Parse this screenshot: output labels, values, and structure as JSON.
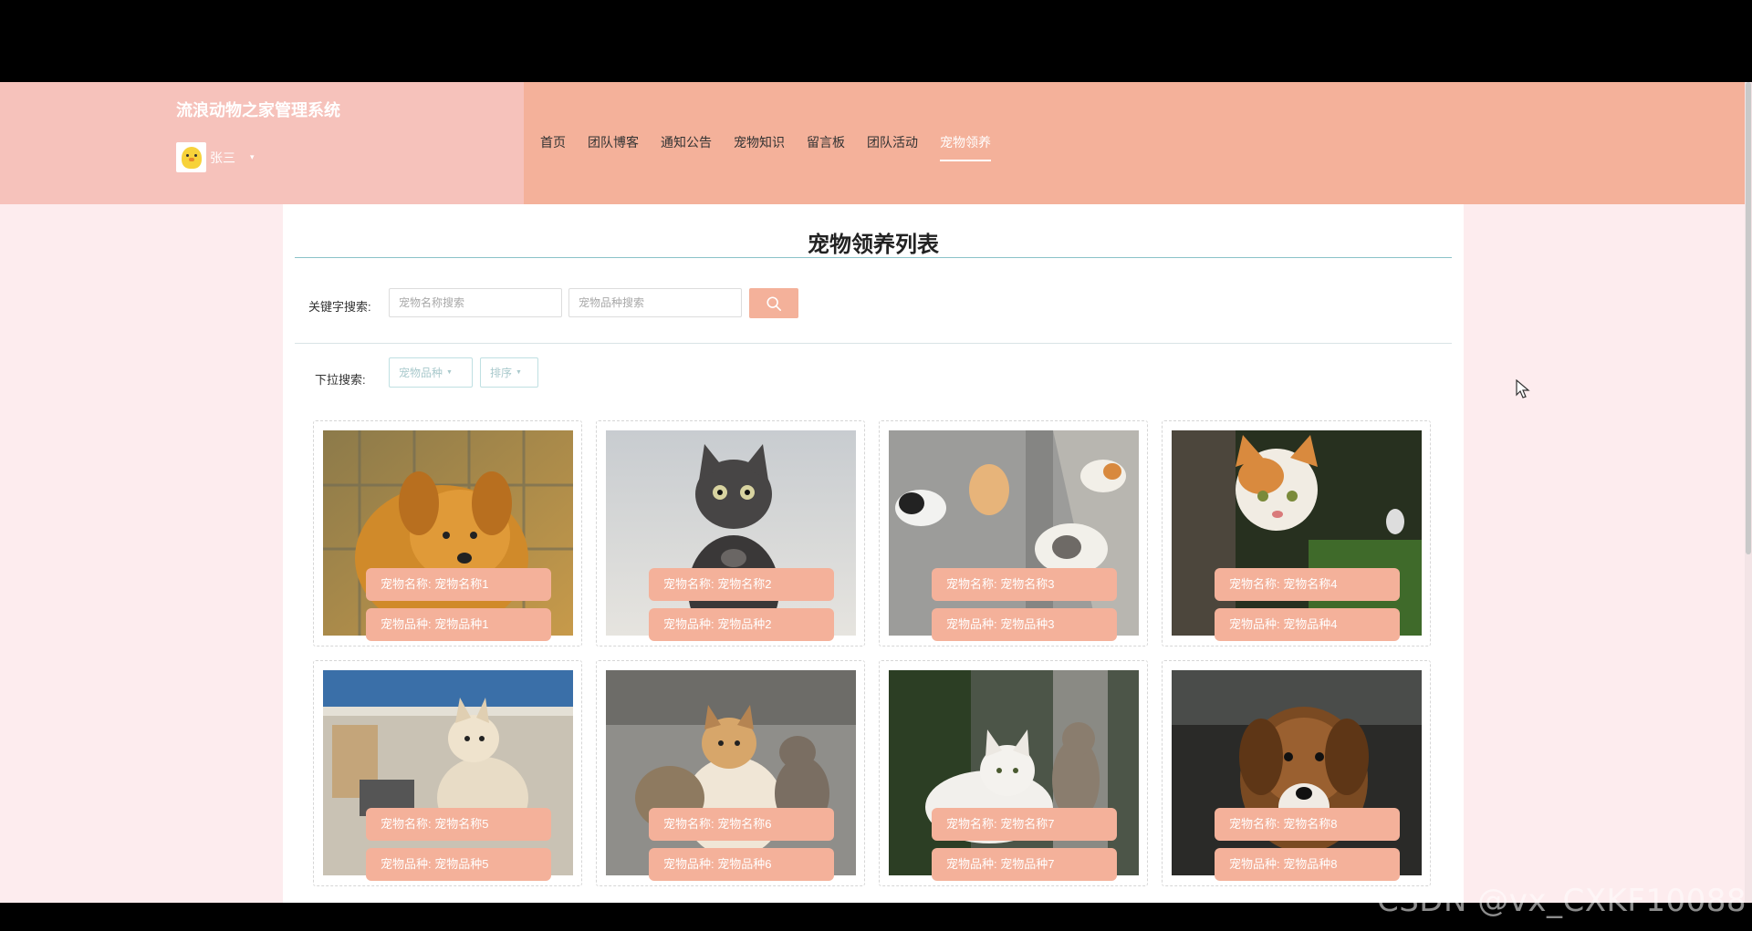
{
  "site": {
    "title": "流浪动物之家管理系统"
  },
  "user": {
    "name": "张三",
    "caret": "▾"
  },
  "nav": [
    {
      "label": "首页"
    },
    {
      "label": "团队博客"
    },
    {
      "label": "通知公告"
    },
    {
      "label": "宠物知识"
    },
    {
      "label": "留言板"
    },
    {
      "label": "团队活动"
    },
    {
      "label": "宠物领养",
      "active": true
    }
  ],
  "page": {
    "title": "宠物领养列表"
  },
  "search": {
    "label": "关键字搜索:",
    "name_placeholder": "宠物名称搜索",
    "kind_placeholder": "宠物品种搜索",
    "icon": "search-icon"
  },
  "dropdowns": {
    "label": "下拉搜索:",
    "kind": "宠物品种",
    "sort": "排序",
    "caret": "▼"
  },
  "pets": [
    {
      "name": "宠物名称: 宠物名称1",
      "kind": "宠物品种: 宠物品种1"
    },
    {
      "name": "宠物名称: 宠物名称2",
      "kind": "宠物品种: 宠物品种2"
    },
    {
      "name": "宠物名称: 宠物名称3",
      "kind": "宠物品种: 宠物品种3"
    },
    {
      "name": "宠物名称: 宠物名称4",
      "kind": "宠物品种: 宠物品种4"
    },
    {
      "name": "宠物名称: 宠物名称5",
      "kind": "宠物品种: 宠物品种5"
    },
    {
      "name": "宠物名称: 宠物名称6",
      "kind": "宠物品种: 宠物品种6"
    },
    {
      "name": "宠物名称: 宠物名称7",
      "kind": "宠物品种: 宠物品种7"
    },
    {
      "name": "宠物名称: 宠物名称8",
      "kind": "宠物品种: 宠物品种8"
    }
  ],
  "colors": {
    "accent": "#f4b19a",
    "header_left": "#f6c2bb",
    "page_bg": "#fdecee"
  },
  "watermark": "CSDN @vx_CXKF10088"
}
